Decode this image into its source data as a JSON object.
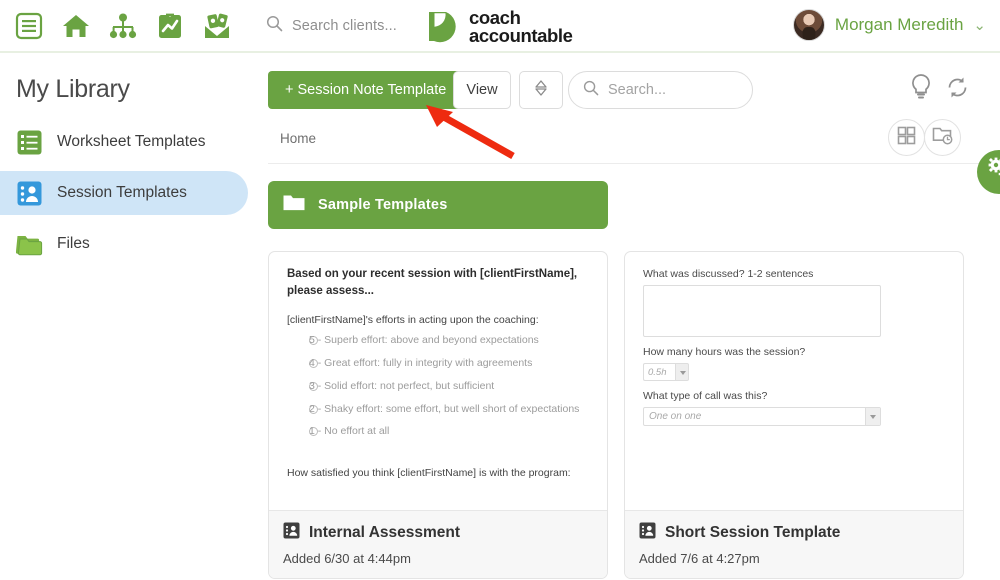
{
  "topbar": {
    "nav_icons": [
      {
        "name": "menu-icon",
        "title": "Menu"
      },
      {
        "name": "home-icon",
        "title": "Home"
      },
      {
        "name": "org-chart-icon",
        "title": "Teams"
      },
      {
        "name": "clipboard-chart-icon",
        "title": "Reports"
      },
      {
        "name": "money-envelope-icon",
        "title": "Billing"
      }
    ],
    "search": {
      "placeholder": "Search clients...",
      "value": ""
    },
    "brand": {
      "line1": "coach",
      "line2": "accountable"
    },
    "user": {
      "name": "Morgan Meredith",
      "caret": "⌄"
    }
  },
  "sidebar": {
    "title": "My Library",
    "items": [
      {
        "label": "Worksheet Templates",
        "icon": "worksheet-list-icon",
        "active": false
      },
      {
        "label": "Session Templates",
        "icon": "session-person-icon",
        "active": true
      },
      {
        "label": "Files",
        "icon": "folder-icon",
        "active": false
      }
    ]
  },
  "toolbar": {
    "new_template_label": "+ Session Note Template",
    "view_label": "View",
    "sort_icon": "sort-updown-icon",
    "search": {
      "placeholder": "Search...",
      "value": ""
    },
    "tip_icon": "lightbulb-icon",
    "sync_icon": "refresh-sync-icon",
    "gear_icon": "gears-settings-icon",
    "accent_green": "#6aa342"
  },
  "breadcrumb": {
    "home_label": "Home",
    "grid_view_icon": "grid-view-icon",
    "folder_view_icon": "folder-clock-view-icon"
  },
  "folder_row": {
    "label": "Sample Templates",
    "icon": "folder-icon",
    "color": "#6aa342"
  },
  "cards": [
    {
      "icon": "session-template-icon",
      "title": "Internal Assessment",
      "added": "Added 6/30 at 4:44pm",
      "preview": {
        "kind": "rating-form",
        "heading": "Based on your recent session with [clientFirstName], please assess...",
        "question": "[clientFirstName]'s efforts in acting upon the coaching:",
        "options": [
          "5 - Superb effort: above and beyond expectations",
          "4 - Great effort: fully in integrity with agreements",
          "3 - Solid effort: not perfect, but sufficient",
          "2 - Shaky effort: some effort, but well short of expectations",
          "1 - No effort at all"
        ],
        "question2": "How satisfied you think [clientFirstName] is with the program:"
      }
    },
    {
      "icon": "session-template-icon",
      "title": "Short Session Template",
      "added": "Added 7/6 at 4:27pm",
      "preview": {
        "kind": "fields-form",
        "field1_label": "What was discussed? 1-2 sentences",
        "field1_value": "",
        "field2_label": "How many hours was the session?",
        "field2_value": "0.5h",
        "field3_label": "What type of call was this?",
        "field3_value": "One on one"
      }
    }
  ],
  "annotation": {
    "kind": "red-arrow",
    "color": "#ee2b10",
    "points_to": "new-session-note-template-button"
  }
}
